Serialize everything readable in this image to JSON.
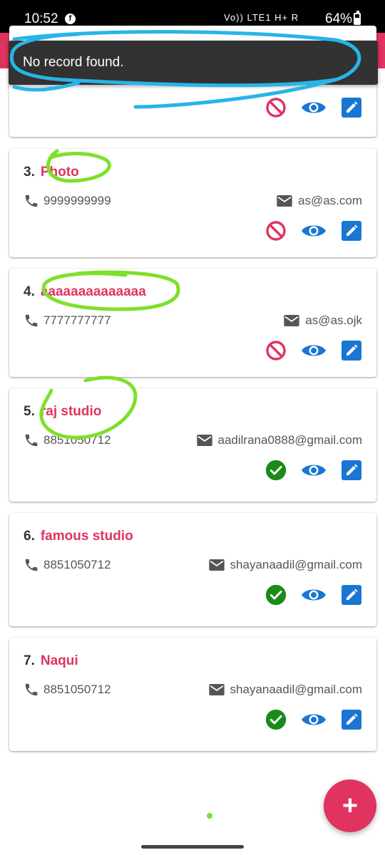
{
  "status_bar": {
    "time": "10:52",
    "network_text": "Vo)) LTE1 H+ R",
    "battery": "64%"
  },
  "toast": {
    "message": "No record found."
  },
  "records": [
    {
      "number": "",
      "name": "",
      "phone": "",
      "email": "",
      "status": "blocked",
      "partially_hidden": true
    },
    {
      "number": "3.",
      "name": "Photo",
      "phone": "9999999999",
      "email": "as@as.com",
      "status": "blocked"
    },
    {
      "number": "4.",
      "name": "aaaaaaaaaaaaaa",
      "phone": "7777777777",
      "email": "as@as.ojk",
      "status": "blocked"
    },
    {
      "number": "5.",
      "name": "raj studio",
      "phone": "8851050712",
      "email": "aadilrana0888@gmail.com",
      "status": "approved"
    },
    {
      "number": "6.",
      "name": "famous studio",
      "phone": "8851050712",
      "email": "shayanaadil@gmail.com",
      "status": "approved"
    },
    {
      "number": "7.",
      "name": "Naqui",
      "phone": "8851050712",
      "email": "shayanaadil@gmail.com",
      "status": "approved"
    }
  ],
  "fab": {
    "label": "+"
  },
  "colors": {
    "accent": "#e0335f",
    "blocked": "#e0335f",
    "approved": "#1a8a1a",
    "action_blue": "#1976d2",
    "annotation_blue": "#27b5e6",
    "annotation_green": "#7ee02b"
  },
  "icons": {
    "blocked": "block-icon",
    "approved": "check-circle-icon",
    "view": "eye-icon",
    "edit": "edit-icon",
    "phone": "phone-icon",
    "email": "mail-icon"
  }
}
